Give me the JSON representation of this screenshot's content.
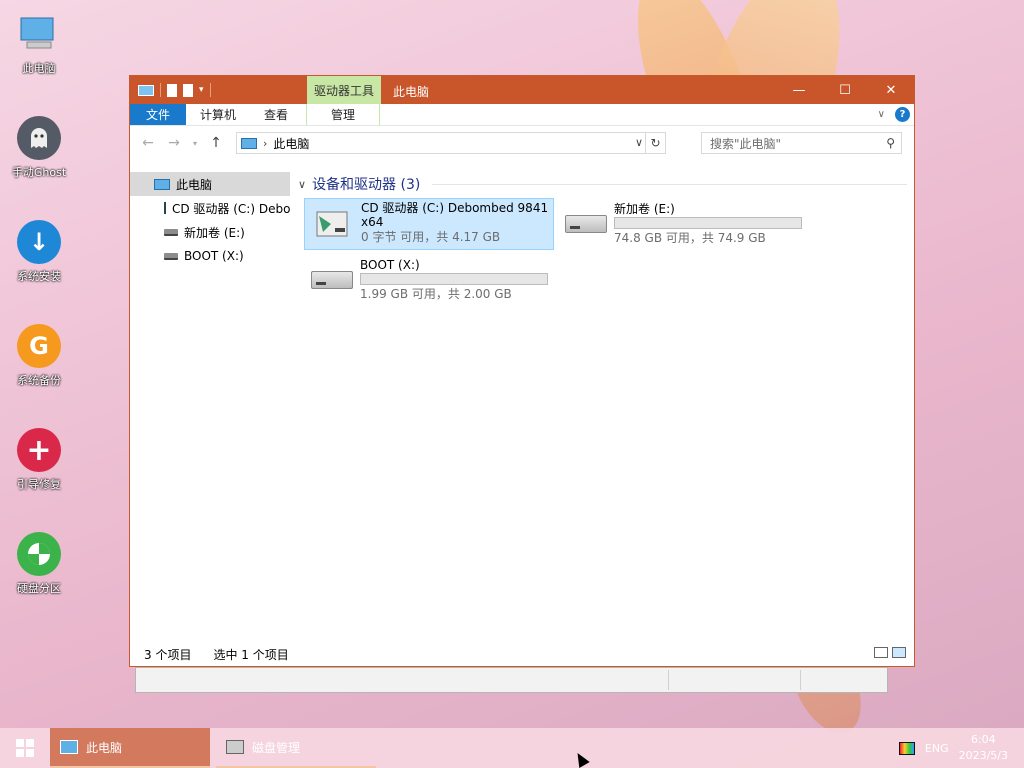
{
  "desktop": {
    "icons": [
      {
        "label": "此电脑",
        "icon": "computer-icon",
        "color": "#5fb0e6"
      },
      {
        "label": "手动Ghost",
        "icon": "ghost-icon",
        "color": "#555b66"
      },
      {
        "label": "系统安装",
        "icon": "download-arrow-icon",
        "color": "#1e88d6"
      },
      {
        "label": "系统备份",
        "icon": "g-logo-icon",
        "color": "#f59a1f"
      },
      {
        "label": "引导修复",
        "icon": "plus-cross-icon",
        "color": "#d9284a"
      },
      {
        "label": "硬盘分区",
        "icon": "partition-icon",
        "color": "#3bb34a"
      }
    ]
  },
  "window": {
    "context_tab": "驱动器工具",
    "title": "此电脑",
    "controls": {
      "minimize": "—",
      "maximize": "☐",
      "close": "✕"
    },
    "ribbon_tabs": [
      "文件",
      "计算机",
      "查看",
      "管理"
    ],
    "address": {
      "location": "此电脑"
    },
    "search": {
      "placeholder": "搜索\"此电脑\""
    },
    "nav_pane": [
      {
        "label": "此电脑",
        "icon": "computer-icon",
        "selected": true
      },
      {
        "label": "CD 驱动器 (C:) Debombed",
        "icon": "cd-drive-icon",
        "selected": false
      },
      {
        "label": "新加卷 (E:)",
        "icon": "drive-icon",
        "selected": false
      },
      {
        "label": "BOOT (X:)",
        "icon": "drive-icon",
        "selected": false
      }
    ],
    "group_header": "设备和驱动器 (3)",
    "drives": [
      {
        "name_line1": "CD 驱动器 (C:) Debombed 9841",
        "name_line2": "x64",
        "free_text": "0 字节 可用，共 4.17 GB",
        "icon": "cd-drive-icon",
        "selected": true,
        "used_fraction": 1.0
      },
      {
        "name_line1": "新加卷 (E:)",
        "name_line2": "",
        "free_text": "74.8 GB 可用，共 74.9 GB",
        "icon": "drive-icon",
        "selected": false,
        "used_fraction": 0.0
      },
      {
        "name_line1": "BOOT (X:)",
        "name_line2": "",
        "free_text": "1.99 GB 可用，共 2.00 GB",
        "icon": "drive-icon",
        "selected": false,
        "used_fraction": 0.0
      }
    ],
    "status": {
      "items": "3 个项目",
      "selected": "选中 1 个项目"
    }
  },
  "taskbar": {
    "items": [
      {
        "label": "此电脑",
        "icon": "computer-icon",
        "active": true
      },
      {
        "label": "磁盘管理",
        "icon": "disk-management-icon",
        "active": false
      }
    ],
    "tray": {
      "lang": "ENG",
      "time": "6:04",
      "date": "2023/5/3"
    }
  },
  "colors": {
    "title_bar": "#c9562a",
    "file_tab": "#1979ca",
    "context_tab": "#c8e7a4",
    "selection": "#cce8ff"
  }
}
